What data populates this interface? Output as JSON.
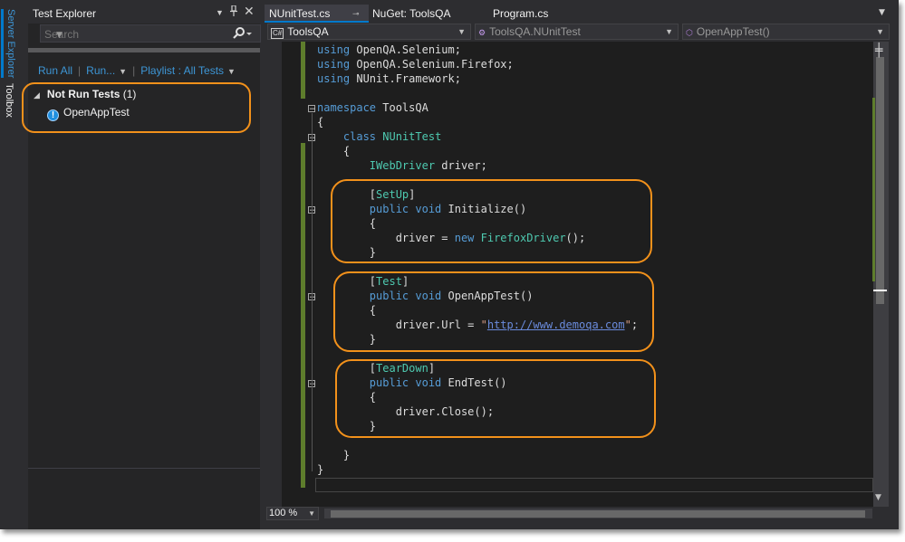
{
  "side_tabs": [
    "Server Explorer",
    "Toolbox"
  ],
  "test_explorer": {
    "title": "Test Explorer",
    "search_placeholder": "Search",
    "toolbar": {
      "run_all": "Run All",
      "run": "Run...",
      "playlist": "Playlist : All Tests"
    },
    "group": {
      "label": "Not Run Tests",
      "count": "(1)"
    },
    "tests": [
      "OpenAppTest"
    ]
  },
  "tabs": [
    {
      "label": "NUnitTest.cs",
      "active": true
    },
    {
      "label": "NuGet: ToolsQA",
      "active": false
    },
    {
      "label": "Program.cs",
      "active": false
    }
  ],
  "nav": {
    "project": "ToolsQA",
    "class": "ToolsQA.NUnitTest",
    "member": "OpenAppTest()"
  },
  "code_lines": [
    [
      {
        "t": "using ",
        "c": "kw"
      },
      {
        "t": "OpenQA.Selenium;"
      }
    ],
    [
      {
        "t": "using ",
        "c": "kw"
      },
      {
        "t": "OpenQA.Selenium.Firefox;"
      }
    ],
    [
      {
        "t": "using ",
        "c": "kw"
      },
      {
        "t": "NUnit.Framework;"
      }
    ],
    [],
    [
      {
        "t": "namespace ",
        "c": "kw"
      },
      {
        "t": "ToolsQA"
      }
    ],
    [
      {
        "t": "{"
      }
    ],
    [
      {
        "t": "    "
      },
      {
        "t": "class ",
        "c": "kw"
      },
      {
        "t": "NUnitTest",
        "c": "ty"
      }
    ],
    [
      {
        "t": "    {"
      }
    ],
    [
      {
        "t": "        "
      },
      {
        "t": "IWebDriver",
        "c": "ty"
      },
      {
        "t": " driver;"
      }
    ],
    [],
    [
      {
        "t": "        ["
      },
      {
        "t": "SetUp",
        "c": "ty"
      },
      {
        "t": "]"
      }
    ],
    [
      {
        "t": "        "
      },
      {
        "t": "public ",
        "c": "kw"
      },
      {
        "t": "void ",
        "c": "kw"
      },
      {
        "t": "Initialize()"
      }
    ],
    [
      {
        "t": "        {"
      }
    ],
    [
      {
        "t": "            driver = "
      },
      {
        "t": "new ",
        "c": "kw"
      },
      {
        "t": "FirefoxDriver",
        "c": "ty"
      },
      {
        "t": "();"
      }
    ],
    [
      {
        "t": "        }"
      }
    ],
    [],
    [
      {
        "t": "        ["
      },
      {
        "t": "Test",
        "c": "ty"
      },
      {
        "t": "]"
      }
    ],
    [
      {
        "t": "        "
      },
      {
        "t": "public ",
        "c": "kw"
      },
      {
        "t": "void ",
        "c": "kw"
      },
      {
        "t": "OpenAppTest()"
      }
    ],
    [
      {
        "t": "        {"
      }
    ],
    [
      {
        "t": "            driver.Url = "
      },
      {
        "t": "\"",
        "c": "str"
      },
      {
        "t": "http://www.demoqa.com",
        "c": "url"
      },
      {
        "t": "\"",
        "c": "str"
      },
      {
        "t": ";"
      }
    ],
    [
      {
        "t": "        }"
      }
    ],
    [],
    [
      {
        "t": "        ["
      },
      {
        "t": "TearDown",
        "c": "ty"
      },
      {
        "t": "]"
      }
    ],
    [
      {
        "t": "        "
      },
      {
        "t": "public ",
        "c": "kw"
      },
      {
        "t": "void ",
        "c": "kw"
      },
      {
        "t": "EndTest()"
      }
    ],
    [
      {
        "t": "        {"
      }
    ],
    [
      {
        "t": "            driver.Close();"
      }
    ],
    [
      {
        "t": "        }"
      }
    ],
    [],
    [
      {
        "t": "    }"
      }
    ],
    [
      {
        "t": "}"
      }
    ]
  ],
  "zoom": "100 %",
  "colors": {
    "highlight": "#f2911b",
    "accent": "#007acc",
    "keyword": "#569cd6",
    "type": "#4ec9b0"
  }
}
